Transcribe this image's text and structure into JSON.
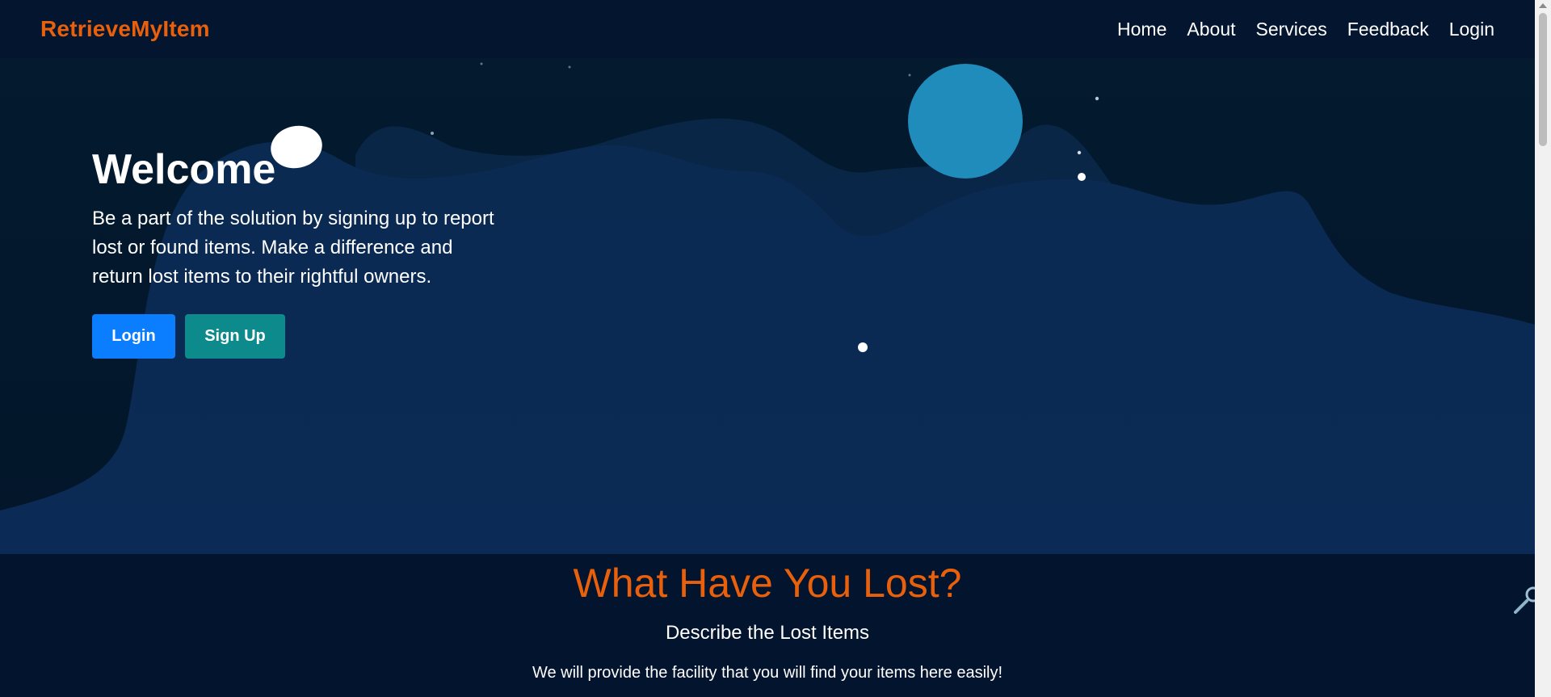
{
  "brand": {
    "name": "RetrieveMyItem",
    "color": "#e8600c"
  },
  "nav": {
    "items": [
      {
        "label": "Home"
      },
      {
        "label": "About"
      },
      {
        "label": "Services"
      },
      {
        "label": "Feedback"
      },
      {
        "label": "Login"
      }
    ]
  },
  "hero": {
    "title": "Welcome",
    "text": "Be a part of the solution by signing up to report lost or found items. Make a difference and return lost items to their rightful owners.",
    "buttons": {
      "login_label": "Login",
      "signup_label": "Sign Up"
    },
    "colors": {
      "login_button": "#0b7dff",
      "signup_button": "#0d8a8c",
      "moon": "#1f8cbb"
    }
  },
  "lost": {
    "title": "What Have You Lost?",
    "subtitle": "Describe the Lost Items",
    "description": "We will provide the facility that you will find your items here easily!"
  },
  "icons": {
    "moon": "moon-circle",
    "cloud": "cloud-ellipse",
    "magnifier": "magnifier-icon"
  }
}
